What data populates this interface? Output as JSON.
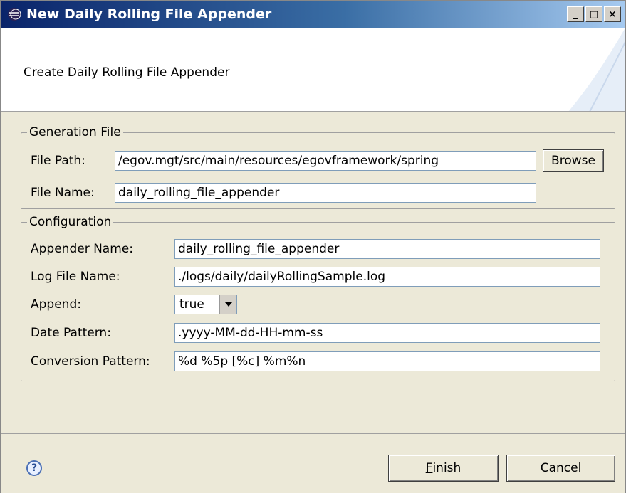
{
  "window": {
    "title": "New Daily Rolling File Appender",
    "controls": {
      "minimize": "_",
      "maximize": "□",
      "close": "×"
    }
  },
  "banner": {
    "heading": "Create Daily Rolling File Appender"
  },
  "generation": {
    "legend": "Generation File",
    "file_path_label": "File Path:",
    "file_path_value": "/egov.mgt/src/main/resources/egovframework/spring",
    "browse_label": "Browse",
    "file_name_label": "File Name:",
    "file_name_value": "daily_rolling_file_appender"
  },
  "configuration": {
    "legend": "Configuration",
    "appender_name_label": "Appender Name:",
    "appender_name_value": "daily_rolling_file_appender",
    "log_file_name_label": "Log File Name:",
    "log_file_name_value": "./logs/daily/dailyRollingSample.log",
    "append_label": "Append:",
    "append_value": "true",
    "date_pattern_label": "Date Pattern:",
    "date_pattern_value": ".yyyy-MM-dd-HH-mm-ss",
    "conversion_pattern_label": "Conversion Pattern:",
    "conversion_pattern_value": "%d %5p [%c] %m%n"
  },
  "footer": {
    "finish_mnemonic": "F",
    "finish_rest": "inish",
    "cancel_label": "Cancel",
    "help_glyph": "?"
  },
  "icons": [
    "eclipse-icon",
    "help-icon",
    "chevron-down-icon"
  ]
}
